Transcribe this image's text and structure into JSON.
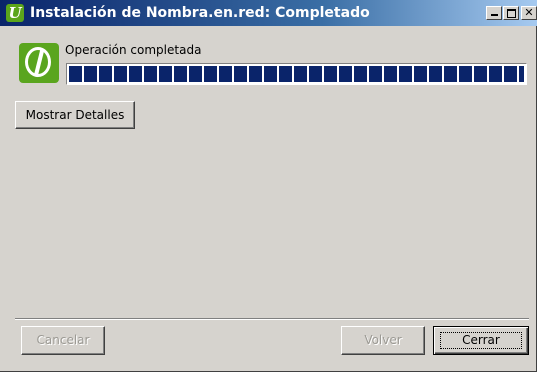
{
  "window": {
    "title": "Instalación de Nombra.en.red: Completado",
    "title_icon_letter": "U",
    "title_icon": "nombra-logo-icon",
    "titlebar_color": "#0a246a",
    "face_color": "#d6d3ce"
  },
  "header": {
    "logo_icon": "nombra-logo-icon",
    "logo_color": "#5aa51e",
    "status_text": "Operación completada"
  },
  "progress": {
    "value": 1.0,
    "fill_color": "#0a246a"
  },
  "buttons": {
    "details_label": "Mostrar Detalles",
    "cancel_label": "Cancelar",
    "back_label": "Volver",
    "close_label": "Cerrar"
  }
}
